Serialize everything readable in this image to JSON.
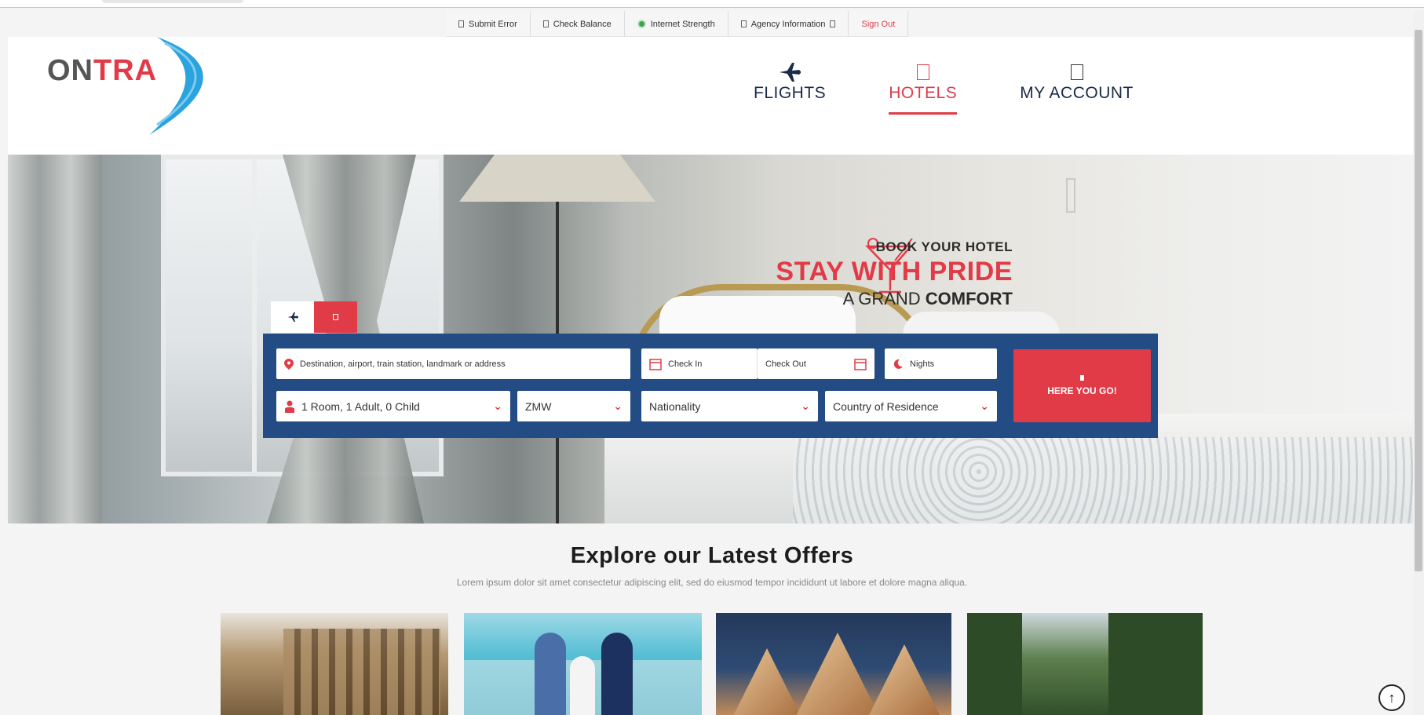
{
  "utility_bar": {
    "items": [
      {
        "label": "Submit Error",
        "icon": "square-icon"
      },
      {
        "label": "Check Balance",
        "icon": "square-icon"
      },
      {
        "label": "Internet Strength",
        "icon": "signal-dot-icon",
        "color": "#3aa64a"
      },
      {
        "label": "Agency Information",
        "icon": "square-icon"
      },
      {
        "label": "Sign Out",
        "color": "#e23b48"
      }
    ]
  },
  "logo": {
    "text_gray": "ON",
    "text_red": "TRA"
  },
  "nav": {
    "flights": "FLIGHTS",
    "hotels": "HOTELS",
    "account": "MY ACCOUNT",
    "active": "HOTELS"
  },
  "hero": {
    "line1": "BOOK YOUR HOTEL",
    "line2": "STAY WITH PRIDE",
    "line3_regular": "A GRAND ",
    "line3_bold": "COMFORT"
  },
  "search": {
    "destination_placeholder": "Destination, airport, train station, landmark or address",
    "check_in": "Check In",
    "check_out": "Check Out",
    "nights": "Nights",
    "rooms": "1 Room, 1 Adult, 0 Child",
    "currency": "ZMW",
    "nationality": "Nationality",
    "residence": "Country of Residence",
    "submit": "HERE YOU GO!"
  },
  "offers": {
    "title": "Explore our Latest Offers",
    "subtitle": "Lorem ipsum dolor sit amet consectetur adipiscing elit, sed do eiusmod tempor incididunt ut labore et dolore magna aliqua."
  },
  "colors": {
    "brand_red": "#e23b48",
    "brand_blue": "#234b84",
    "text_dark": "#1a2a4a"
  }
}
